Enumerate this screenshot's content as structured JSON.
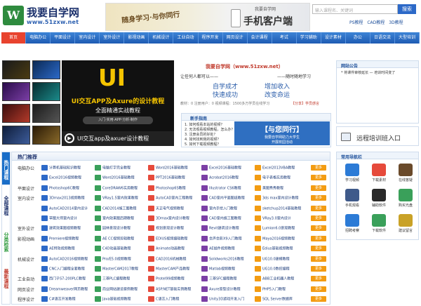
{
  "header": {
    "logo_text": "我要自学网",
    "logo_url": "www.51zxw.net",
    "banner_ink": "随身学习·与你同行",
    "banner_sub": "我要自学网",
    "banner_big": "手机客户端",
    "search_placeholder": "输入课程名、关键词",
    "search_button": "搜索",
    "hot_links": [
      "PS教程",
      "CAD教程",
      "3D教程"
    ]
  },
  "nav": [
    "首页",
    "电脑办公",
    "平面设计",
    "室内设计",
    "室外设计",
    "影视动画",
    "机械设计",
    "工业自动",
    "程序开发",
    "网页设计",
    "会计课程",
    "考试",
    "学习辅助",
    "设计素材",
    "办公",
    "日语交流",
    "大型培训"
  ],
  "hero": {
    "title": "UI",
    "line1": "UI交互APP及Axure的设计教程",
    "line2": "全面精通实战教程",
    "line3": "入门·实用·APP·分析·制作",
    "bottom": "UI交互app及axuer设计教程"
  },
  "intro": {
    "heading": "我要自学网（www.51zxw.net）",
    "q1": "让任何人都可以——",
    "q2": "——随时随地学习",
    "slogan1": "自学成才",
    "slogan2": "快速成功",
    "slogan3": "增加收入",
    "slogan4": "改变命运",
    "footer": "教材：0  注册用户：0  视频课程：1500多万学员在线学习",
    "footer_link": "【分享】学员感言"
  },
  "guide": {
    "title": "新手指南",
    "items": [
      "1. 如何观看本站的视频？",
      "2. 无法观看视频教程，怎么办？",
      "3. 注册会员的好处？",
      "4. 如何找到我的视频？",
      "5. 如何下载视频教程？"
    ]
  },
  "companion": {
    "title": "【与您同行】",
    "line1": "我要自学网助力大学生",
    "line2": "开展校园活动"
  },
  "notice": {
    "title": "网站公告",
    "items": [
      "* 将课件审核延长 — 培训时间变了"
    ]
  },
  "remote": {
    "label": "远程培训班入口"
  },
  "side_tabs": [
    "热门课程",
    "全部课程",
    "分类检索",
    "最新课程"
  ],
  "hot": {
    "title": "热门推荐",
    "more_label": "更多",
    "rows": [
      {
        "cat": "电脑办公",
        "items": [
          "计算机基础知识教程",
          "电脑打字完全教程",
          "Word2016基础教程",
          "Excel2016基础教程",
          "Excel2013VBA教程"
        ]
      },
      {
        "cat": "",
        "items": [
          "Excel2016视频教程",
          "Word2016基础教程",
          "PPT2016基础教程",
          "Acrobat2016教程",
          "电子表格实用教程"
        ]
      },
      {
        "cat": "平面设计",
        "items": [
          "Photoshop6C教程",
          "CoreDRAW6实用教程",
          "Photoshop6S教程",
          "Illustrator CS6教程",
          "美图秀秀教程"
        ]
      },
      {
        "cat": "室内设计",
        "items": [
          "3Dmax2013视频教程",
          "VRay1.5室内效果教程",
          "AutoCAD室内工程教程",
          "CAD室内平面图纸教程",
          "3ds max室内设计教程"
        ]
      },
      {
        "cat": "",
        "items": [
          "AutoCAD2014室内设计",
          "CAD2014施工图教程",
          "天正电气视频教程",
          "室内手绘入门教程",
          "sketchup2014基础教程"
        ]
      },
      {
        "cat": "",
        "items": [
          "草图大师室内设计",
          "室内效果图后期教程",
          "3Dmax室内设计教程",
          "CAD室内施工图教程",
          "VRay3.0室内设计"
        ]
      },
      {
        "cat": "室外设计",
        "items": [
          "建筑效果图视频教程",
          "园林景观设计教程",
          "规划景观设计教程",
          "Revit建筑设计教程",
          "Lumion6.0景观教程"
        ]
      },
      {
        "cat": "影视动画",
        "items": [
          "Premiere视频教程",
          "AE CC视频剪辑教程",
          "EDIUS视频编辑教程",
          "会声会影X9入门教程",
          "Maya2016视频教程"
        ]
      },
      {
        "cat": "",
        "items": [
          "AE特效视频教程",
          "C4D动画基础教程",
          "Animate动画教程",
          "AE插件视频教程",
          "Edius基础视频教程"
        ]
      },
      {
        "cat": "机械设计",
        "items": [
          "AutoCAD2016视频教程",
          "Pro/E5.0视频教程",
          "CAD2016机械教程",
          "Solidworks2016教程",
          "UG10.0建模教程"
        ]
      },
      {
        "cat": "",
        "items": [
          "CNC入门编程全套教程",
          "MasterCAM2017教程",
          "MasterCAM产品教程",
          "Matlab视频教程",
          "UG10.0数控编程"
        ]
      },
      {
        "cat": "工业自动",
        "items": [
          "西门子S7-200PLC教程",
          "三菱PLC编程教程",
          "Protel99视频教程",
          "三菱SFC编程教程",
          "ABB工业机器人教程"
        ]
      },
      {
        "cat": "网页设计",
        "items": [
          "Dreamweaver网页教程",
          "商业网站建设案例教程",
          "ASP.NET基础实例教程",
          "Axure原型设计教程",
          "PHP5入门教程"
        ]
      },
      {
        "cat": "程序设计",
        "items": [
          "C#语言开发教程",
          "Java基础视频教程",
          "C语言入门教程",
          "Unity3D游戏开发入门",
          "SQL Server数据库"
        ]
      }
    ]
  },
  "quick": {
    "title": "常用导航栏",
    "items": [
      {
        "label": "学习视频",
        "color": "#2c7bd6"
      },
      {
        "label": "下载素材",
        "color": "#e64a3b"
      },
      {
        "label": "在线答疑",
        "color": "#6a4a2b"
      },
      {
        "label": "手机观看",
        "color": "#3f5a8a"
      },
      {
        "label": "辅助软件",
        "color": "#2a2a2a"
      },
      {
        "label": "购买光盘",
        "color": "#3aa05a"
      },
      {
        "label": "招聘考察",
        "color": "#2c7bd6"
      },
      {
        "label": "下载软件",
        "color": "#3aa05a"
      },
      {
        "label": "建议留言",
        "color": "#c9a227"
      }
    ]
  }
}
